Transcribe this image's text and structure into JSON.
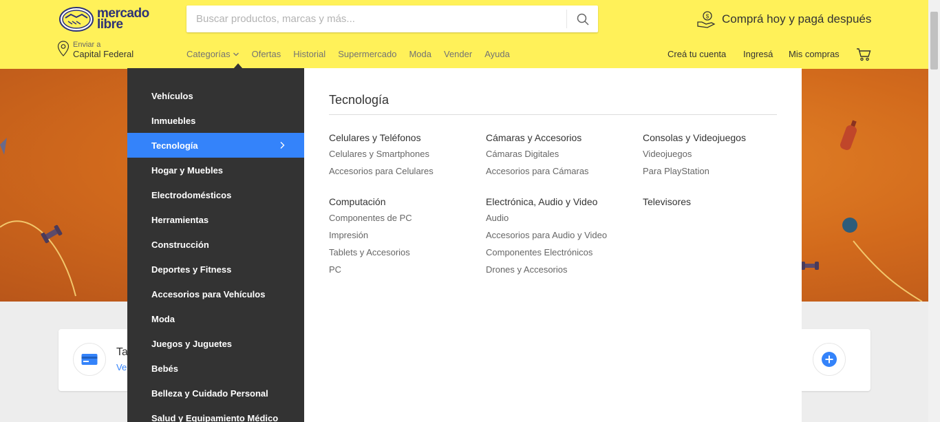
{
  "header": {
    "logo_line1": "mercado",
    "logo_line2": "libre",
    "search_placeholder": "Buscar productos, marcas y más...",
    "promo": "Comprá hoy y pagá después",
    "location_small": "Enviar a",
    "location_big": "Capital Federal",
    "nav": [
      "Categorías",
      "Ofertas",
      "Historial",
      "Supermercado",
      "Moda",
      "Vender",
      "Ayuda"
    ],
    "user_nav": [
      "Creá tu cuenta",
      "Ingresá",
      "Mis compras"
    ]
  },
  "categories": [
    "Vehículos",
    "Inmuebles",
    "Tecnología",
    "Hogar y Muebles",
    "Electrodomésticos",
    "Herramientas",
    "Construcción",
    "Deportes y Fitness",
    "Accesorios para Vehículos",
    "Moda",
    "Juegos y Juguetes",
    "Bebés",
    "Belleza y Cuidado Personal",
    "Salud y Equipamiento Médico"
  ],
  "active_category": "Tecnología",
  "subpanel": {
    "title": "Tecnología",
    "groups": [
      {
        "title": "Celulares y Teléfonos",
        "links": [
          "Celulares y Smartphones",
          "Accesorios para Celulares"
        ]
      },
      {
        "title": "Cámaras y Accesorios",
        "links": [
          "Cámaras Digitales",
          "Accesorios para Cámaras"
        ]
      },
      {
        "title": "Consolas y Videojuegos",
        "links": [
          "Videojuegos",
          "Para PlayStation"
        ]
      },
      {
        "title": "Computación",
        "links": [
          "Componentes de PC",
          "Impresión",
          "Tablets y Accesorios",
          "PC"
        ]
      },
      {
        "title": "Electrónica, Audio y Video",
        "links": [
          "Audio",
          "Accesorios para Audio y Video",
          "Componentes Electrónicos",
          "Drones y Accesorios"
        ]
      },
      {
        "title": "Televisores",
        "links": []
      }
    ]
  },
  "card": {
    "title": "Ta",
    "link": "Ve"
  },
  "colors": {
    "header_bg": "#fff159",
    "menu_bg": "#333333",
    "active_bg": "#3483fa",
    "hero_bg": "#d9731f"
  }
}
